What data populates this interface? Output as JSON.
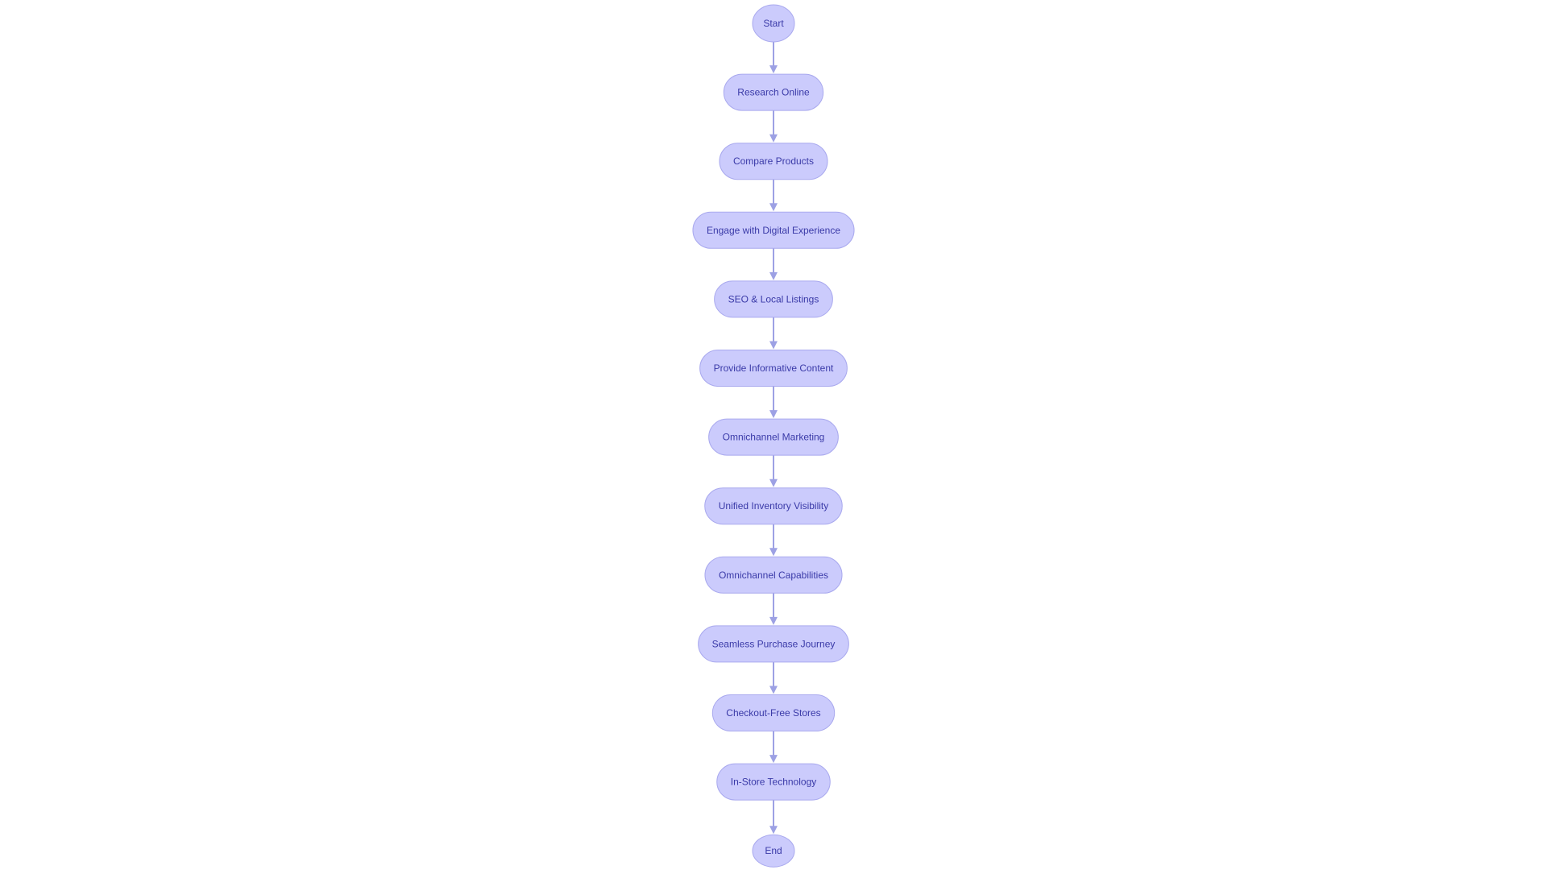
{
  "diagram": {
    "type": "flowchart",
    "direction": "top-to-bottom",
    "colors": {
      "node_fill": "#cbcbfc",
      "node_stroke": "#a9a9ee",
      "edge": "#9da1e4",
      "text": "#3a3aa8"
    },
    "nodes": [
      {
        "id": "start",
        "label": "Start",
        "shape": "circle"
      },
      {
        "id": "research-online",
        "label": "Research Online",
        "shape": "stadium"
      },
      {
        "id": "compare-products",
        "label": "Compare Products",
        "shape": "stadium"
      },
      {
        "id": "engage-digital",
        "label": "Engage with Digital Experience",
        "shape": "stadium"
      },
      {
        "id": "seo-local",
        "label": "SEO & Local Listings",
        "shape": "stadium"
      },
      {
        "id": "informative-content",
        "label": "Provide Informative Content",
        "shape": "stadium"
      },
      {
        "id": "omnichannel-marketing",
        "label": "Omnichannel Marketing",
        "shape": "stadium"
      },
      {
        "id": "unified-inventory",
        "label": "Unified Inventory Visibility",
        "shape": "stadium"
      },
      {
        "id": "omnichannel-capabilities",
        "label": "Omnichannel Capabilities",
        "shape": "stadium"
      },
      {
        "id": "seamless-purchase",
        "label": "Seamless Purchase Journey",
        "shape": "stadium"
      },
      {
        "id": "checkout-free",
        "label": "Checkout-Free Stores",
        "shape": "stadium"
      },
      {
        "id": "in-store-tech",
        "label": "In-Store Technology",
        "shape": "stadium"
      },
      {
        "id": "end",
        "label": "End",
        "shape": "circle"
      }
    ],
    "edges": [
      {
        "from": "start",
        "to": "research-online"
      },
      {
        "from": "research-online",
        "to": "compare-products"
      },
      {
        "from": "compare-products",
        "to": "engage-digital"
      },
      {
        "from": "engage-digital",
        "to": "seo-local"
      },
      {
        "from": "seo-local",
        "to": "informative-content"
      },
      {
        "from": "informative-content",
        "to": "omnichannel-marketing"
      },
      {
        "from": "omnichannel-marketing",
        "to": "unified-inventory"
      },
      {
        "from": "unified-inventory",
        "to": "omnichannel-capabilities"
      },
      {
        "from": "omnichannel-capabilities",
        "to": "seamless-purchase"
      },
      {
        "from": "seamless-purchase",
        "to": "checkout-free"
      },
      {
        "from": "checkout-free",
        "to": "in-store-tech"
      },
      {
        "from": "in-store-tech",
        "to": "end"
      }
    ]
  }
}
